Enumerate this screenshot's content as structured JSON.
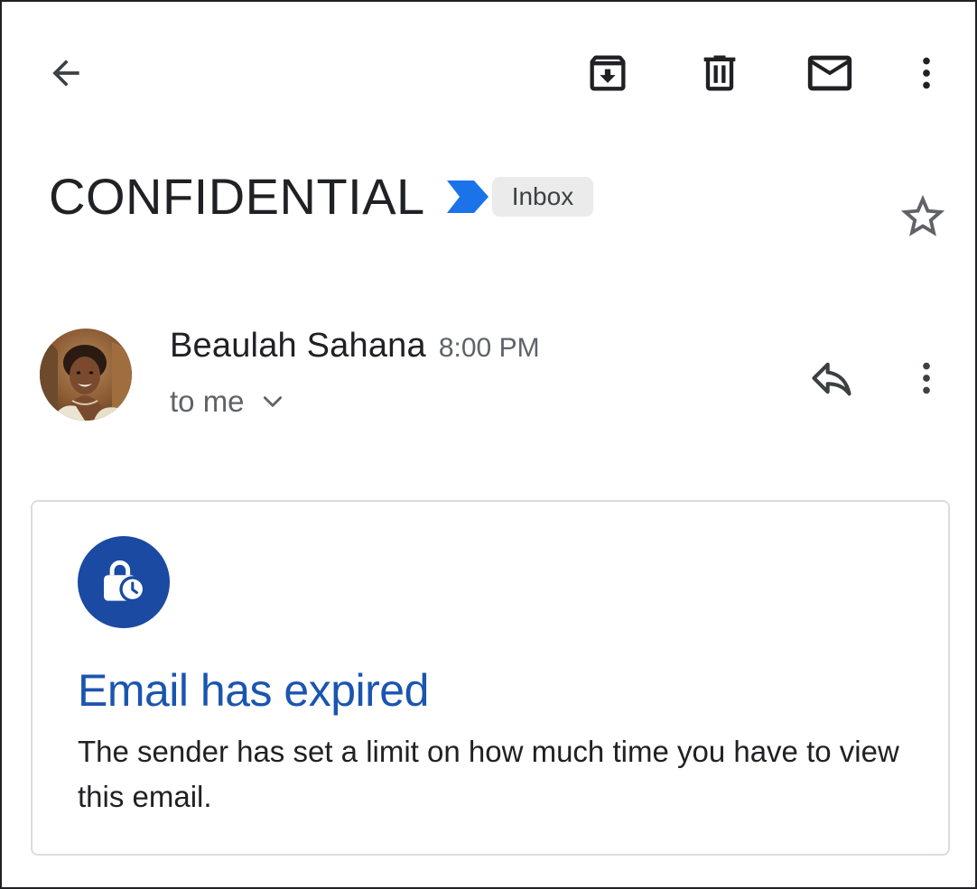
{
  "toolbar": {
    "back_icon": "arrow-back-icon",
    "archive_icon": "archive-icon",
    "delete_icon": "trash-icon",
    "mark_unread_icon": "mail-icon",
    "more_icon": "more-vert-icon"
  },
  "header": {
    "subject": "CONFIDENTIAL",
    "importance_icon": "importance-marker-icon",
    "importance_color": "#1a73e8",
    "label": "Inbox",
    "star_icon": "star-outline-icon"
  },
  "message": {
    "sender_name": "Beaulah Sahana",
    "time": "8:00 PM",
    "recipient": "to me",
    "avatar_icon": "sender-avatar",
    "reply_icon": "reply-icon",
    "more_icon": "more-vert-icon"
  },
  "expired_card": {
    "icon": "lock-clock-icon",
    "icon_bg": "#1a4aa1",
    "title": "Email has expired",
    "body": "The sender has set a limit on how much time you have to view this email."
  }
}
